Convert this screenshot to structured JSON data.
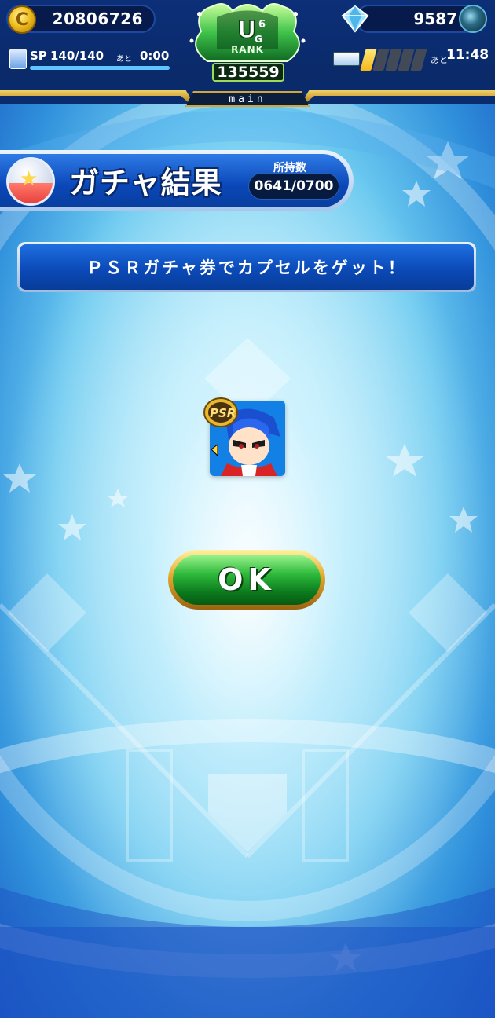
{
  "header": {
    "coins": "20806726",
    "coin_icon_glyph": "C",
    "gems": "9587",
    "sp_label": "SP",
    "sp_value": "140/140",
    "sp_ato": "あと",
    "sp_time": "0:00",
    "sp_fill_fraction": 1.0,
    "stamina_ato": "あと",
    "stamina_time": "11:48",
    "stamina_segments_on": 1,
    "stamina_segments_total": 5,
    "rank_tier": "6",
    "rank_label": "RANK",
    "rank_value": "135559",
    "main_tab": "main"
  },
  "gacha": {
    "title": "ガチャ結果",
    "owned_label": "所持数",
    "owned_value": "0641/0700"
  },
  "message": "ＰＳＲガチャ券でカプセルをゲット！",
  "result": {
    "badge": "PSR"
  },
  "ok_label": "OK",
  "colors": {
    "accent_blue": "#0b4ab8",
    "ok_green": "#2cb83a",
    "gold": "#e3a62c"
  }
}
